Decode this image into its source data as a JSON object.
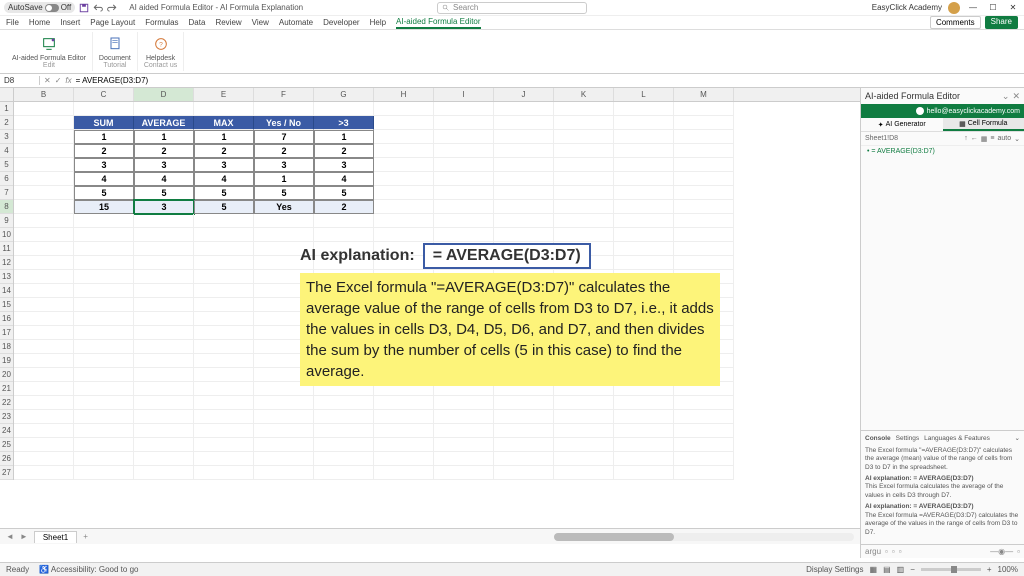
{
  "titlebar": {
    "autosave": "AutoSave",
    "autosave_state": "Off",
    "doc_title": "AI aided Formula Editor - AI Formula Explanation",
    "search_placeholder": "Search",
    "account": "EasyClick Academy",
    "comments": "Comments",
    "share": "Share"
  },
  "ribbon": {
    "tabs": [
      "File",
      "Home",
      "Insert",
      "Page Layout",
      "Formulas",
      "Data",
      "Review",
      "View",
      "Automate",
      "Developer",
      "Help",
      "AI-aided Formula Editor"
    ],
    "active_index": 11,
    "groups": [
      {
        "label": "Edit",
        "items": [
          "AI-aided Formula Editor"
        ]
      },
      {
        "label": "Tutorial",
        "items": [
          "Document"
        ]
      },
      {
        "label": "Contact us",
        "items": [
          "Helpdesk"
        ]
      }
    ]
  },
  "formula_bar": {
    "cell_ref": "D8",
    "formula": "= AVERAGE(D3:D7)"
  },
  "columns": [
    "B",
    "C",
    "D",
    "E",
    "F",
    "G",
    "H",
    "I",
    "J",
    "K",
    "L",
    "M"
  ],
  "rows": [
    "1",
    "2",
    "3",
    "4",
    "5",
    "6",
    "7",
    "8",
    "9",
    "10",
    "11",
    "12",
    "13",
    "14",
    "15",
    "16",
    "17",
    "18",
    "19",
    "20",
    "21",
    "22",
    "23",
    "24",
    "25",
    "26",
    "27"
  ],
  "selected_col_index": 2,
  "selected_row_index": 7,
  "table": {
    "headers": [
      "SUM",
      "AVERAGE",
      "MAX",
      "Yes / No",
      ">3"
    ],
    "rows": [
      [
        "1",
        "1",
        "1",
        "7",
        "1"
      ],
      [
        "2",
        "2",
        "2",
        "2",
        "2"
      ],
      [
        "3",
        "3",
        "3",
        "3",
        "3"
      ],
      [
        "4",
        "4",
        "4",
        "1",
        "4"
      ],
      [
        "5",
        "5",
        "5",
        "5",
        "5"
      ],
      [
        "15",
        "3",
        "5",
        "Yes",
        "2"
      ]
    ]
  },
  "explanation": {
    "title": "AI explanation:",
    "formula": "= AVERAGE(D3:D7)",
    "body": "The Excel formula \"=AVERAGE(D3:D7)\" calculates the average value of the range of cells from D3 to D7, i.e., it adds the values in cells D3, D4, D5, D6, and D7, and then divides the sum by the number of cells (5 in this case) to find the average."
  },
  "sheet_tabs": {
    "active": "Sheet1",
    "add": "+"
  },
  "statusbar": {
    "ready": "Ready",
    "accessibility": "Accessibility: Good to go",
    "display_settings": "Display Settings",
    "zoom": "100%"
  },
  "side_panel": {
    "title": "AI-aided Formula Editor",
    "email": "hello@easyclickacademy.com",
    "modes": [
      "AI Generator",
      "Cell Formula"
    ],
    "active_mode": 1,
    "sheet_ref": "Sheet1!D8",
    "auto": "auto",
    "formula_item": "= AVERAGE(D3:D7)",
    "bottom_tabs": [
      "Console",
      "Settings",
      "Languages & Features"
    ],
    "console_text": "The Excel formula \"=AVERAGE(D3:D7)\" calculates the average (mean) value of the range of cells from D3 to D7 in the spreadsheet.",
    "expl1_label": "AI explanation:",
    "expl1_formula": "= AVERAGE(D3:D7)",
    "expl1_text": "This Excel formula calculates the average of the values in cells D3 through D7.",
    "expl2_label": "AI explanation:",
    "expl2_formula": "= AVERAGE(D3:D7)",
    "expl2_text": "The Excel formula =AVERAGE(D3:D7) calculates the average of the values in the range of cells from D3 to D7.",
    "footer": "argu"
  },
  "chart_data": {
    "type": "table",
    "title": "Spreadsheet sample data",
    "columns": [
      "SUM",
      "AVERAGE",
      "MAX",
      "Yes / No",
      ">3"
    ],
    "rows": [
      [
        1,
        1,
        1,
        7,
        1
      ],
      [
        2,
        2,
        2,
        2,
        2
      ],
      [
        3,
        3,
        3,
        3,
        3
      ],
      [
        4,
        4,
        4,
        1,
        4
      ],
      [
        5,
        5,
        5,
        5,
        5
      ],
      [
        15,
        3,
        5,
        "Yes",
        2
      ]
    ]
  }
}
